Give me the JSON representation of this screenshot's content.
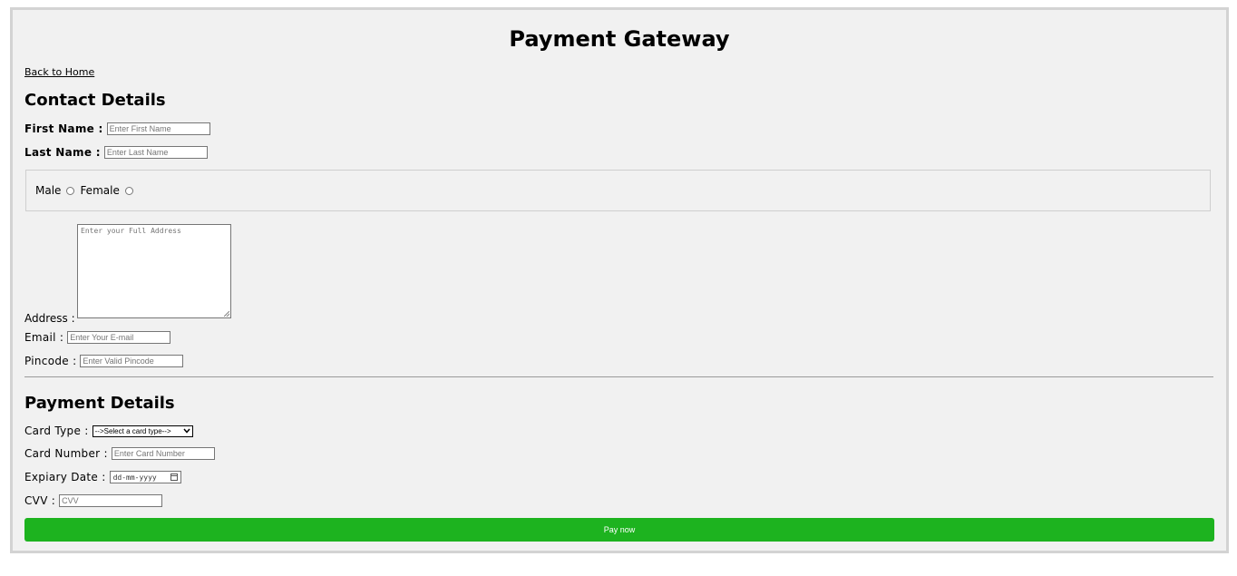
{
  "header": {
    "title": "Payment Gateway",
    "back_link": "Back to Home"
  },
  "contact": {
    "section_title": "Contact Details",
    "first_name": {
      "label": "First Name :",
      "placeholder": "Enter First Name"
    },
    "last_name": {
      "label": "Last Name :",
      "placeholder": "Enter Last Name"
    },
    "gender": {
      "male_label": "Male",
      "female_label": "Female"
    },
    "address": {
      "label": "Address :",
      "placeholder": "Enter your Full Address"
    },
    "email": {
      "label": "Email :",
      "placeholder": "Enter Your E-mail"
    },
    "pincode": {
      "label": "Pincode :",
      "placeholder": "Enter Valid Pincode"
    }
  },
  "payment": {
    "section_title": "Payment Details",
    "card_type": {
      "label": "Card Type :",
      "selected": "-->Select a card type-->"
    },
    "card_number": {
      "label": "Card Number :",
      "placeholder": "Enter Card Number"
    },
    "expiry": {
      "label": "Expiary Date :",
      "placeholder": "dd-mm-yyyy"
    },
    "cvv": {
      "label": "CVV :",
      "placeholder": "CVV"
    },
    "pay_button": "Pay now",
    "pay_button_color": "#1db31f"
  },
  "icons": [
    "calendar-icon",
    "chevron-down-icon",
    "radio-icon"
  ]
}
